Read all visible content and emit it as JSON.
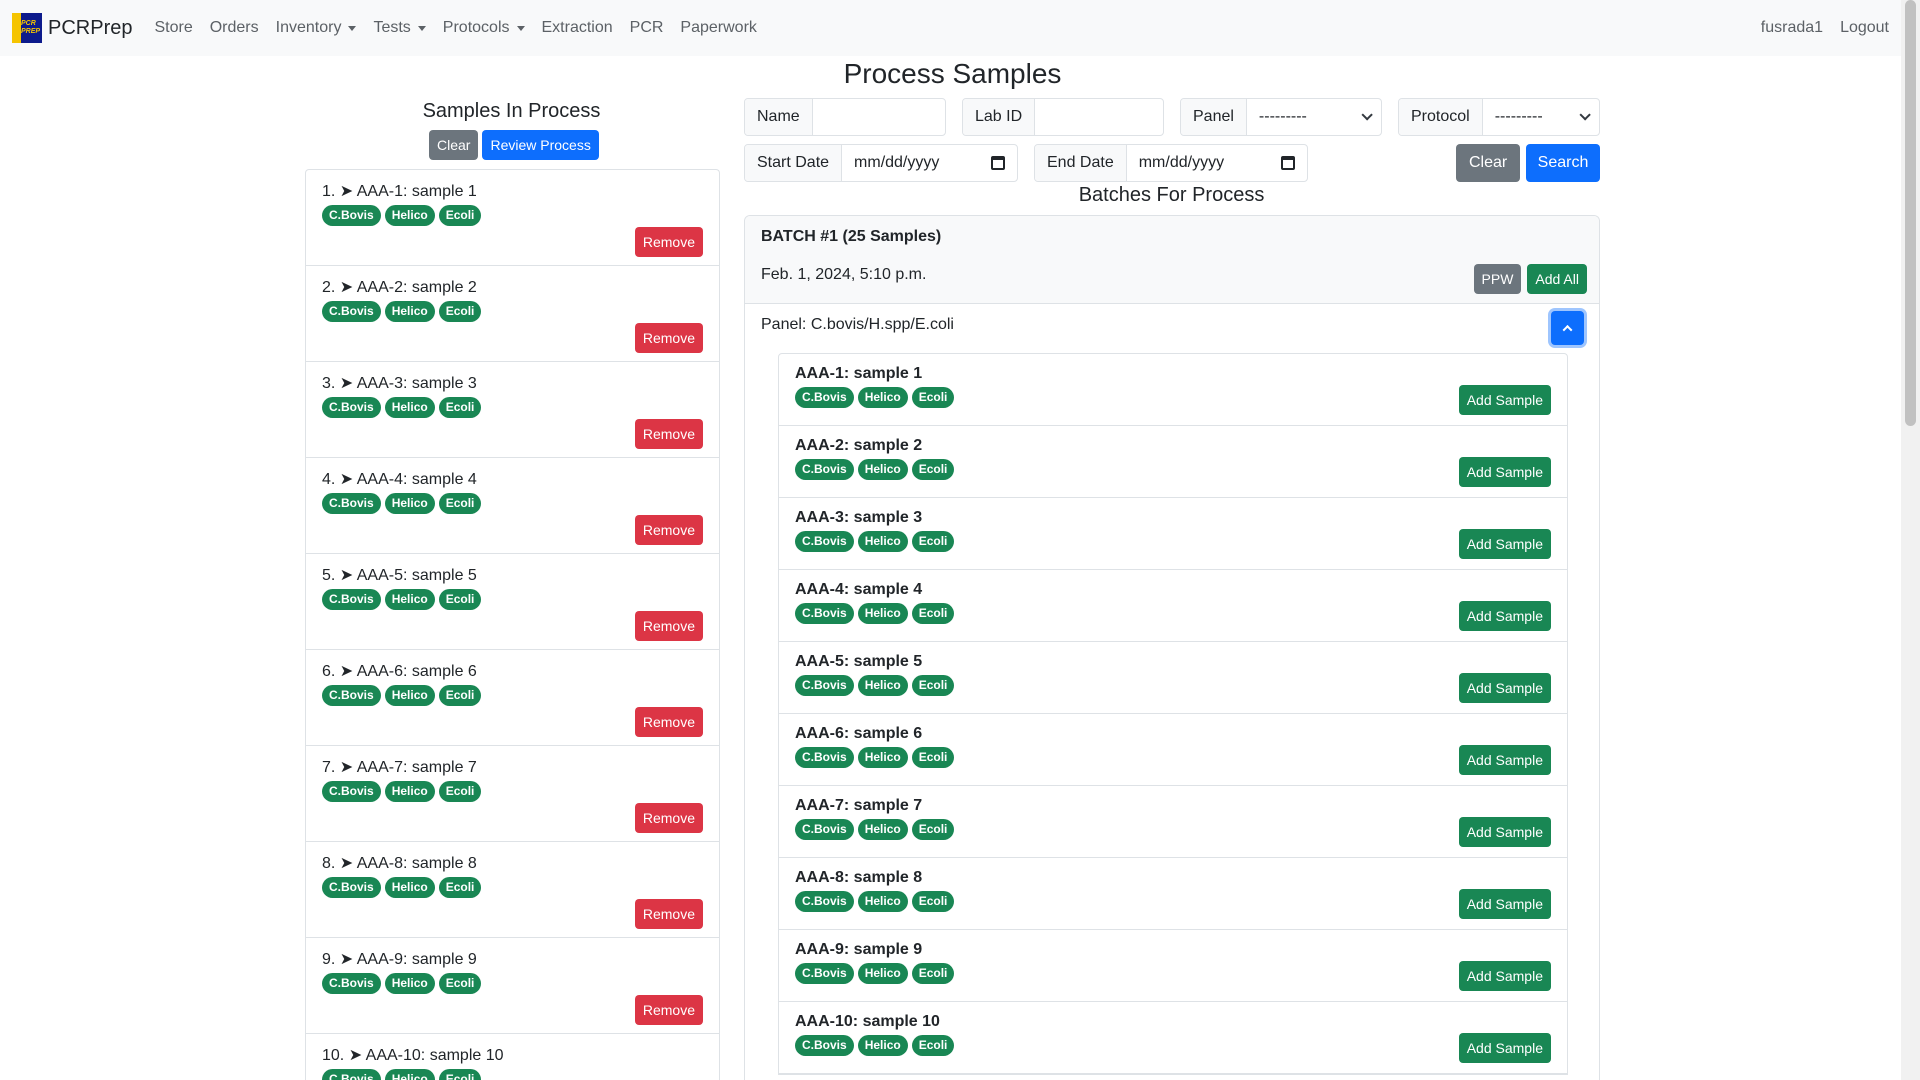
{
  "nav": {
    "brand": "PCRPrep",
    "logo_text": "PCR PREP",
    "items": [
      {
        "label": "Store",
        "dropdown": false
      },
      {
        "label": "Orders",
        "dropdown": false
      },
      {
        "label": "Inventory",
        "dropdown": true
      },
      {
        "label": "Tests",
        "dropdown": true
      },
      {
        "label": "Protocols",
        "dropdown": true
      },
      {
        "label": "Extraction",
        "dropdown": false
      },
      {
        "label": "PCR",
        "dropdown": false
      },
      {
        "label": "Paperwork",
        "dropdown": false
      }
    ],
    "user": "fusrada1",
    "logout": "Logout"
  },
  "page_title": "Process Samples",
  "in_process": {
    "heading": "Samples In Process",
    "clear_label": "Clear",
    "review_label": "Review Process",
    "remove_label": "Remove",
    "items": [
      {
        "title": "1. ➤ AAA-1: sample 1",
        "tags": [
          "C.Bovis",
          "Helico",
          "Ecoli"
        ]
      },
      {
        "title": "2. ➤ AAA-2: sample 2",
        "tags": [
          "C.Bovis",
          "Helico",
          "Ecoli"
        ]
      },
      {
        "title": "3. ➤ AAA-3: sample 3",
        "tags": [
          "C.Bovis",
          "Helico",
          "Ecoli"
        ]
      },
      {
        "title": "4. ➤ AAA-4: sample 4",
        "tags": [
          "C.Bovis",
          "Helico",
          "Ecoli"
        ]
      },
      {
        "title": "5. ➤ AAA-5: sample 5",
        "tags": [
          "C.Bovis",
          "Helico",
          "Ecoli"
        ]
      },
      {
        "title": "6. ➤ AAA-6: sample 6",
        "tags": [
          "C.Bovis",
          "Helico",
          "Ecoli"
        ]
      },
      {
        "title": "7. ➤ AAA-7: sample 7",
        "tags": [
          "C.Bovis",
          "Helico",
          "Ecoli"
        ]
      },
      {
        "title": "8. ➤ AAA-8: sample 8",
        "tags": [
          "C.Bovis",
          "Helico",
          "Ecoli"
        ]
      },
      {
        "title": "9. ➤ AAA-9: sample 9",
        "tags": [
          "C.Bovis",
          "Helico",
          "Ecoli"
        ]
      },
      {
        "title": "10. ➤ AAA-10: sample 10",
        "tags": [
          "C.Bovis",
          "Helico",
          "Ecoli"
        ]
      }
    ]
  },
  "filters": {
    "name_label": "Name",
    "name_value": "",
    "labid_label": "Lab ID",
    "labid_value": "",
    "panel_label": "Panel",
    "panel_value": "---------",
    "protocol_label": "Protocol",
    "protocol_value": "---------",
    "start_label": "Start Date",
    "start_value": "mm/dd/yyyy",
    "end_label": "End Date",
    "end_value": "mm/dd/yyyy",
    "clear_label": "Clear",
    "search_label": "Search"
  },
  "batches": {
    "heading": "Batches For Process",
    "batch": {
      "title": "BATCH #1 (25 Samples)",
      "date": "Feb. 1, 2024, 5:10 p.m.",
      "ppw_label": "PPW",
      "add_all_label": "Add All",
      "panel": "Panel: C.bovis/H.spp/E.coli",
      "add_label": "Add Sample",
      "samples": [
        {
          "title": "AAA-1: sample 1",
          "tags": [
            "C.Bovis",
            "Helico",
            "Ecoli"
          ]
        },
        {
          "title": "AAA-2: sample 2",
          "tags": [
            "C.Bovis",
            "Helico",
            "Ecoli"
          ]
        },
        {
          "title": "AAA-3: sample 3",
          "tags": [
            "C.Bovis",
            "Helico",
            "Ecoli"
          ]
        },
        {
          "title": "AAA-4: sample 4",
          "tags": [
            "C.Bovis",
            "Helico",
            "Ecoli"
          ]
        },
        {
          "title": "AAA-5: sample 5",
          "tags": [
            "C.Bovis",
            "Helico",
            "Ecoli"
          ]
        },
        {
          "title": "AAA-6: sample 6",
          "tags": [
            "C.Bovis",
            "Helico",
            "Ecoli"
          ]
        },
        {
          "title": "AAA-7: sample 7",
          "tags": [
            "C.Bovis",
            "Helico",
            "Ecoli"
          ]
        },
        {
          "title": "AAA-8: sample 8",
          "tags": [
            "C.Bovis",
            "Helico",
            "Ecoli"
          ]
        },
        {
          "title": "AAA-9: sample 9",
          "tags": [
            "C.Bovis",
            "Helico",
            "Ecoli"
          ]
        },
        {
          "title": "AAA-10: sample 10",
          "tags": [
            "C.Bovis",
            "Helico",
            "Ecoli"
          ]
        }
      ]
    }
  },
  "colors": {
    "primary": "#0d6efd",
    "success": "#198754",
    "danger": "#dc3545",
    "secondary": "#6c757d"
  }
}
